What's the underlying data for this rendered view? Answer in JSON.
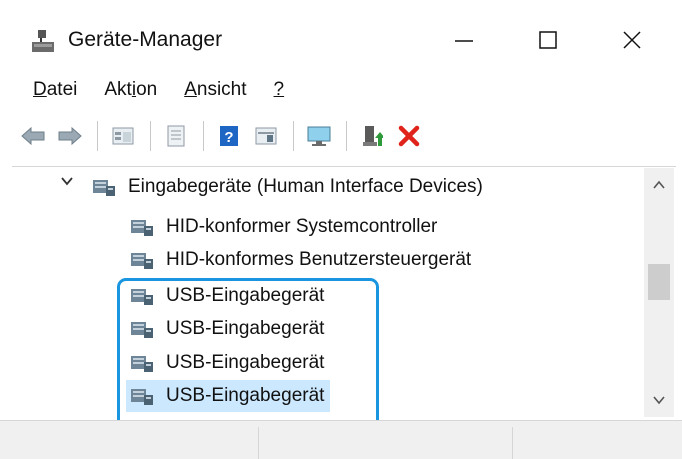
{
  "window": {
    "title": "Geräte-Manager",
    "controls": [
      "minimize-icon",
      "maximize-icon",
      "close-icon"
    ]
  },
  "menu": {
    "items": [
      {
        "mnemonic": "D",
        "rest": "atei"
      },
      {
        "pre": "Akt",
        "mnemonic": "i",
        "rest": "on"
      },
      {
        "mnemonic": "A",
        "rest": "nsicht"
      },
      {
        "mnemonic": "?",
        "rest": ""
      }
    ]
  },
  "toolbar": {
    "icons": [
      "back-arrow-icon",
      "forward-arrow-icon",
      "properties-icon",
      "document-icon",
      "help-icon",
      "view-icon",
      "monitor-icon",
      "update-driver-icon",
      "uninstall-icon"
    ],
    "colors": {
      "help": "#1d66c4",
      "uninstall": "#e0231b",
      "update": "#2e9a3b"
    }
  },
  "tree": {
    "category": "Eingabegeräte (Human Interface Devices)",
    "items": [
      "HID-konformer Systemcontroller",
      "HID-konformes Benutzersteuergerät",
      "USB-Eingabegerät",
      "USB-Eingabegerät",
      "USB-Eingabegerät",
      "USB-Eingabegerät"
    ],
    "selected_index": 5
  },
  "colors": {
    "selection": "#cce8ff",
    "highlight_border": "#1a96e0"
  }
}
